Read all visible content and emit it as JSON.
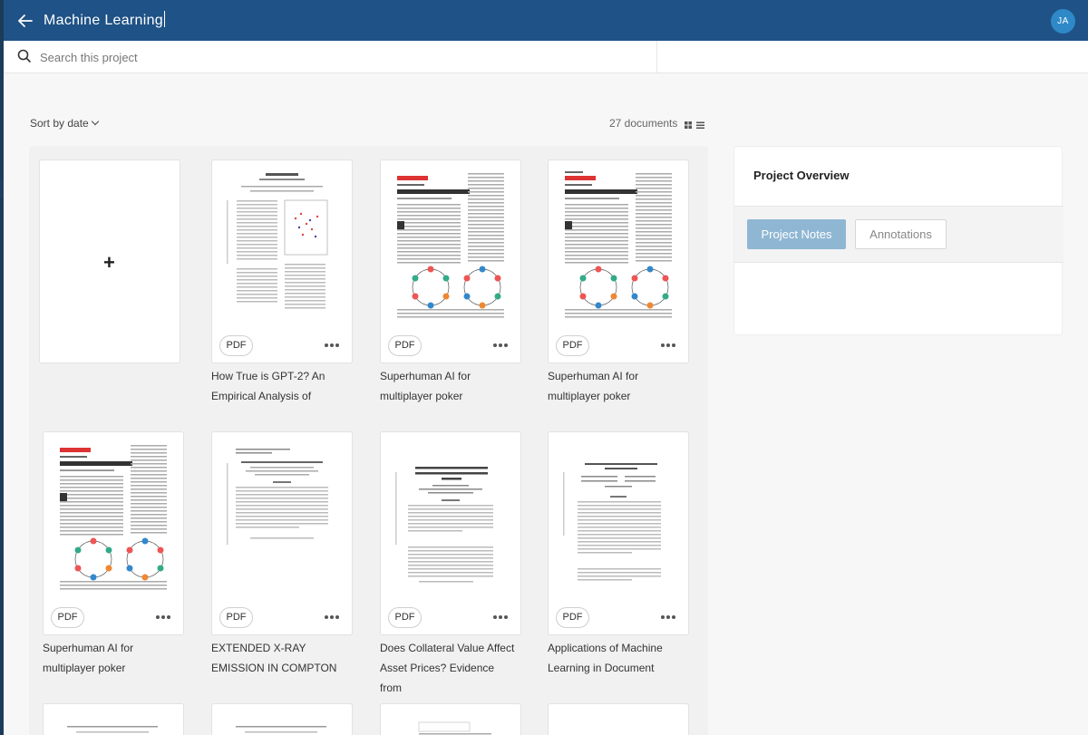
{
  "header": {
    "title": "Machine Learning",
    "avatar_initials": "JA"
  },
  "search": {
    "placeholder": "Search this project"
  },
  "toolbar": {
    "sort_label": "Sort by date",
    "doc_count": "27 documents"
  },
  "documents": [
    {
      "type": "PDF",
      "title_line1": "How True is GPT-2? An",
      "title_line2": "Empirical Analysis of"
    },
    {
      "type": "PDF",
      "title_line1": "Superhuman AI for",
      "title_line2": "multiplayer poker"
    },
    {
      "type": "PDF",
      "title_line1": "Superhuman AI for",
      "title_line2": "multiplayer poker"
    },
    {
      "type": "PDF",
      "title_line1": "Superhuman AI for",
      "title_line2": "multiplayer poker"
    },
    {
      "type": "PDF",
      "title_line1": "EXTENDED X-RAY",
      "title_line2": "EMISSION IN COMPTON"
    },
    {
      "type": "PDF",
      "title_line1": "Does Collateral Value Affect",
      "title_line2": "Asset Prices? Evidence from"
    },
    {
      "type": "PDF",
      "title_line1": "Applications of Machine",
      "title_line2": "Learning in Document"
    }
  ],
  "overview": {
    "title": "Project Overview",
    "tabs": [
      "Project Notes",
      "Annotations"
    ]
  },
  "colors": {
    "header_bg": "#1f5286",
    "avatar_bg": "#2f89c8",
    "active_tab_bg": "#8fb7d3"
  }
}
